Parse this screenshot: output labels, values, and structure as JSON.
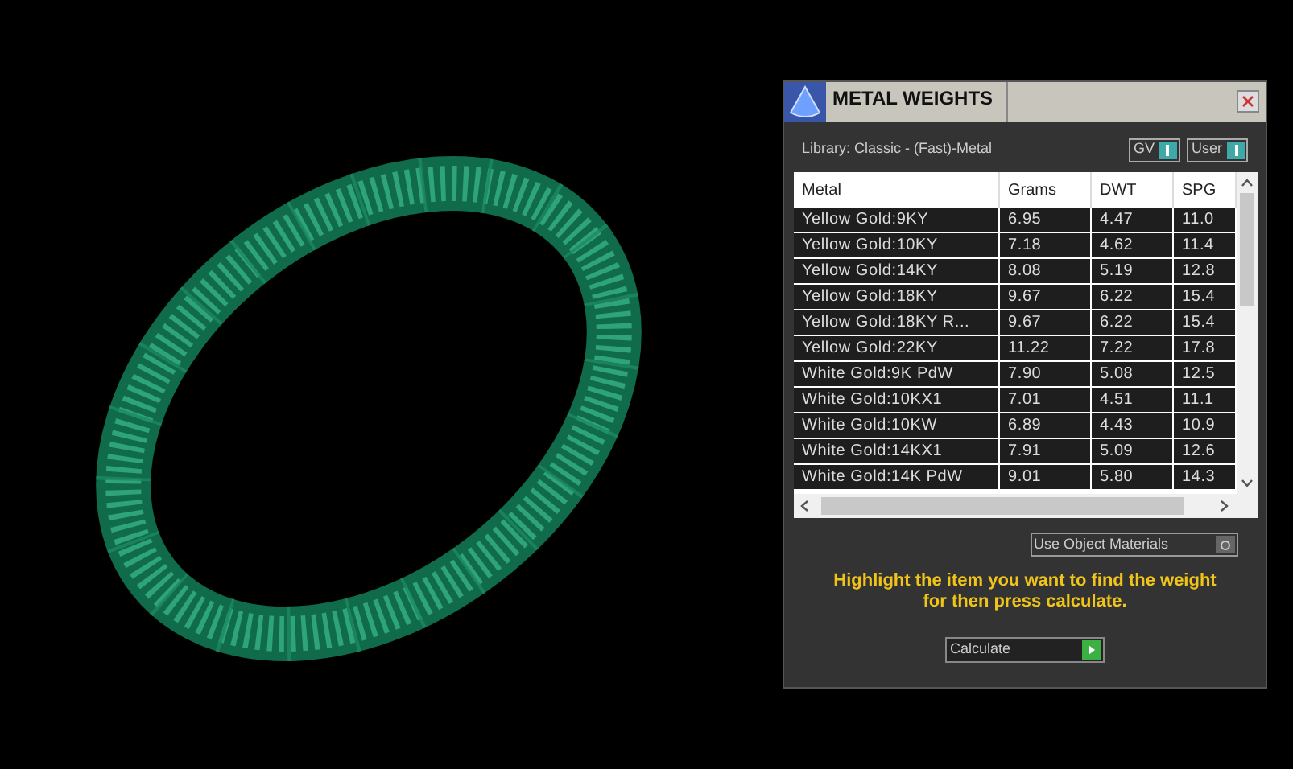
{
  "panel": {
    "title": "METAL WEIGHTS",
    "library": "Library: Classic - (Fast)-Metal",
    "toggles": [
      {
        "label": "GV",
        "on": true
      },
      {
        "label": "User",
        "on": true
      }
    ],
    "table": {
      "columns": [
        "Metal",
        "Grams",
        "DWT",
        "SPG"
      ],
      "rows": [
        [
          "Yellow Gold:9KY",
          "6.95",
          "4.47",
          "11.0"
        ],
        [
          "Yellow Gold:10KY",
          "7.18",
          "4.62",
          "11.4"
        ],
        [
          "Yellow Gold:14KY",
          "8.08",
          "5.19",
          "12.8"
        ],
        [
          "Yellow Gold:18KY",
          "9.67",
          "6.22",
          "15.4"
        ],
        [
          "Yellow Gold:18KY R...",
          "9.67",
          "6.22",
          "15.4"
        ],
        [
          "Yellow Gold:22KY",
          "11.22",
          "7.22",
          "17.8"
        ],
        [
          "White Gold:9K PdW",
          "7.90",
          "5.08",
          "12.5"
        ],
        [
          "White Gold:10KX1",
          "7.01",
          "4.51",
          "11.1"
        ],
        [
          "White Gold:10KW",
          "6.89",
          "4.43",
          "10.9"
        ],
        [
          "White Gold:14KX1",
          "7.91",
          "5.09",
          "12.6"
        ],
        [
          "White Gold:14K PdW",
          "9.01",
          "5.80",
          "14.3"
        ]
      ]
    },
    "use_object_materials": {
      "label": "Use Object Materials",
      "on": false
    },
    "instructions": "Highlight the item you want to find the weight for then press calculate.",
    "calculate_button": "Calculate"
  }
}
